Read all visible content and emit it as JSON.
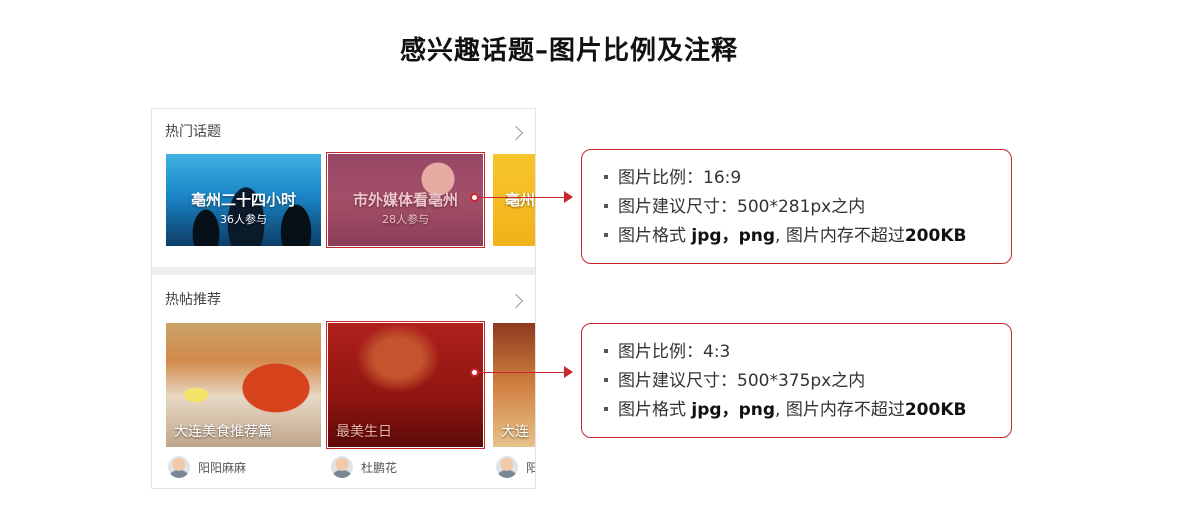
{
  "page": {
    "title": "感兴趣话题–图片比例及注释"
  },
  "hot_topics": {
    "heading": "热门话题",
    "tiles": [
      {
        "title": "亳州二十四小时",
        "subtitle": "36人参与"
      },
      {
        "title": "市外媒体看亳州",
        "subtitle": "28人参与"
      },
      {
        "title": "亳州",
        "subtitle": ""
      }
    ]
  },
  "hot_posts": {
    "heading": "热帖推荐",
    "cards": [
      {
        "title": "大连美食推荐篇",
        "author": "阳阳麻麻"
      },
      {
        "title": "最美生日",
        "author": "杜鹏花"
      },
      {
        "title": "大连",
        "author": "阳"
      }
    ]
  },
  "spec_topics": {
    "rows": [
      {
        "label": "图片比例：",
        "value": "16:9"
      },
      {
        "label": "图片建议尺寸：",
        "value": "500*281px之内"
      },
      {
        "label": "图片格式 ",
        "value_bold": "jpg，png",
        "value_tail": ", 图片内存不超过",
        "value_bold2": "200KB"
      }
    ]
  },
  "spec_posts": {
    "rows": [
      {
        "label": "图片比例：",
        "value": "4:3"
      },
      {
        "label": "图片建议尺寸：",
        "value": "500*375px之内"
      },
      {
        "label": "图片格式 ",
        "value_bold": "jpg，png",
        "value_tail": ", 图片内存不超过",
        "value_bold2": "200KB"
      }
    ]
  },
  "colors": {
    "accent": "#c9262e",
    "divider": "#eeeeee"
  },
  "icons": [
    "chevron-right-icon",
    "avatar"
  ]
}
